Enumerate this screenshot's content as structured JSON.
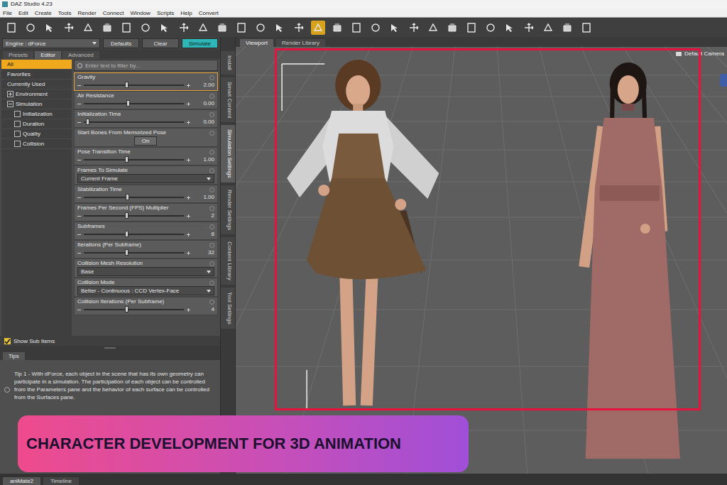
{
  "window": {
    "title": "DAZ Studio 4.23"
  },
  "menu": [
    "File",
    "Edit",
    "Create",
    "Tools",
    "Render",
    "Connect",
    "Window",
    "Scripts",
    "Help",
    "Convert"
  ],
  "toolbar": [
    {
      "selected": false
    },
    {
      "selected": false
    },
    {
      "selected": false
    },
    {
      "selected": false
    },
    {
      "selected": false
    },
    {
      "selected": false
    },
    {
      "selected": false
    },
    {
      "selected": false
    },
    {
      "selected": false
    },
    {
      "selected": false
    },
    {
      "selected": false
    },
    {
      "selected": false
    },
    {
      "selected": false
    },
    {
      "selected": false
    },
    {
      "selected": false
    },
    {
      "selected": false
    },
    {
      "selected": true
    },
    {
      "selected": false
    },
    {
      "selected": false
    },
    {
      "selected": false
    },
    {
      "selected": false
    },
    {
      "selected": false
    },
    {
      "selected": false
    },
    {
      "selected": false
    },
    {
      "selected": false
    },
    {
      "selected": false
    },
    {
      "selected": false
    },
    {
      "selected": false
    },
    {
      "selected": false
    },
    {
      "selected": false
    },
    {
      "selected": false
    }
  ],
  "engine": {
    "label": "Engine : dForce"
  },
  "actions": [
    {
      "label": "Defaults",
      "selected": false
    },
    {
      "label": "Clear",
      "selected": false
    },
    {
      "label": "Simulate",
      "selected": true
    }
  ],
  "tabs": [
    {
      "label": "Presets",
      "selected": false
    },
    {
      "label": "Editor",
      "selected": true
    },
    {
      "label": "Advanced",
      "selected": false
    }
  ],
  "tree": [
    {
      "label": "All",
      "selected": true,
      "kind": "plain",
      "expanded": false,
      "children": []
    },
    {
      "label": "Favorites",
      "selected": false,
      "kind": "plain",
      "expanded": false,
      "children": []
    },
    {
      "label": "Currently Used",
      "selected": false,
      "kind": "plain",
      "expanded": false,
      "children": []
    },
    {
      "label": "Environment",
      "selected": false,
      "kind": "group",
      "expanded": false,
      "children": []
    },
    {
      "label": "Simulation",
      "selected": false,
      "kind": "group",
      "expanded": true,
      "children": [
        {
          "label": "Initialization",
          "selected": false
        },
        {
          "label": "Duration",
          "selected": false
        },
        {
          "label": "Quality",
          "selected": false
        },
        {
          "label": "Collision",
          "selected": false
        }
      ]
    }
  ],
  "filter": {
    "placeholder": "Enter text to filter by..."
  },
  "params": [
    {
      "kind": "slider",
      "label": "Gravity",
      "value": "2.00",
      "level": 0.43,
      "selected": true
    },
    {
      "kind": "slider",
      "label": "Air Resistance",
      "value": "0.00",
      "level": 0.45,
      "selected": false
    },
    {
      "kind": "slider",
      "label": "Initialization Time",
      "value": "0.00",
      "level": 0.04,
      "selected": false
    },
    {
      "kind": "toggle",
      "label": "Start Bones From Memorized Pose",
      "value": "On",
      "level": 1,
      "selected": false
    },
    {
      "kind": "slider",
      "label": "Pose Transition Time",
      "value": "1.00",
      "level": 0.43,
      "selected": false
    },
    {
      "kind": "select",
      "label": "Frames To Simulate",
      "value": "Current Frame",
      "level": 0,
      "selected": false
    },
    {
      "kind": "slider",
      "label": "Stabilization Time",
      "value": "1.00",
      "level": 0.44,
      "selected": false
    },
    {
      "kind": "slider",
      "label": "Frames Per Second (FPS) Multiplier",
      "value": "2",
      "level": 0.43,
      "selected": false
    },
    {
      "kind": "slider",
      "label": "Subframes",
      "value": "8",
      "level": 0.43,
      "selected": false
    },
    {
      "kind": "slider",
      "label": "Iterations (Per Subframe)",
      "value": "32",
      "level": 0.43,
      "selected": false
    },
    {
      "kind": "select",
      "label": "Collision Mesh Resolution",
      "value": "Base",
      "level": 0,
      "selected": false
    },
    {
      "kind": "select",
      "label": "Collision Mode",
      "value": "Better - Continuous : CCD Vertex-Face",
      "level": 0,
      "selected": false
    },
    {
      "kind": "slider",
      "label": "Collision Iterations (Per Subframe)",
      "value": "4",
      "level": 0.43,
      "selected": false
    }
  ],
  "show_sub_items": {
    "label": "Show Sub Items",
    "checked": true
  },
  "tips": {
    "tab": "Tips",
    "text": "Tip 1 - With dForce, each object in the scene that has its own geometry can participate in a simulation. The participation of each object can be controlled from the Parameters pane and the behavior of each surface can be controlled from the Surfaces pane."
  },
  "side_tabs": [
    {
      "label": "Install",
      "selected": false
    },
    {
      "label": "Smart Content",
      "selected": false
    },
    {
      "label": "Simulation Settings",
      "selected": true
    },
    {
      "label": "Render Settings",
      "selected": false
    },
    {
      "label": "Content Library",
      "selected": false
    },
    {
      "label": "Tool Settings",
      "selected": false
    }
  ],
  "viewport": {
    "tabs": [
      {
        "label": "Viewport",
        "selected": true
      },
      {
        "label": "Render Library",
        "selected": false
      }
    ],
    "camera": "Default Camera"
  },
  "bottom_tabs": [
    {
      "label": "aniMate2",
      "selected": true
    },
    {
      "label": "Timeline",
      "selected": false
    }
  ],
  "banner": {
    "text": "CHARACTER DEVELOPMENT FOR 3D ANIMATION"
  }
}
